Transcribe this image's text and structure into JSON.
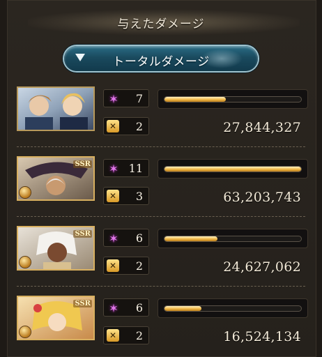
{
  "header": {
    "title": "与えたダメージ"
  },
  "dropdown": {
    "label": "トータルダメージ",
    "icon": "triangle-down-icon"
  },
  "colors": {
    "accent_bar": "#f0b848",
    "hit_icon": "#e078e8",
    "dropdown_bg": "#1a4a5e"
  },
  "ssr_label": "SSR",
  "rows": [
    {
      "portrait": "party-portrait-1",
      "ssr": false,
      "hits": "7",
      "ca": "2",
      "bar_fraction": 0.45,
      "damage": "27,844,327"
    },
    {
      "portrait": "party-portrait-2",
      "ssr": true,
      "hits": "11",
      "ca": "3",
      "bar_fraction": 1.0,
      "damage": "63,203,743"
    },
    {
      "portrait": "party-portrait-3",
      "ssr": true,
      "hits": "6",
      "ca": "2",
      "bar_fraction": 0.39,
      "damage": "24,627,062"
    },
    {
      "portrait": "party-portrait-4",
      "ssr": true,
      "hits": "6",
      "ca": "2",
      "bar_fraction": 0.27,
      "damage": "16,524,134"
    }
  ]
}
